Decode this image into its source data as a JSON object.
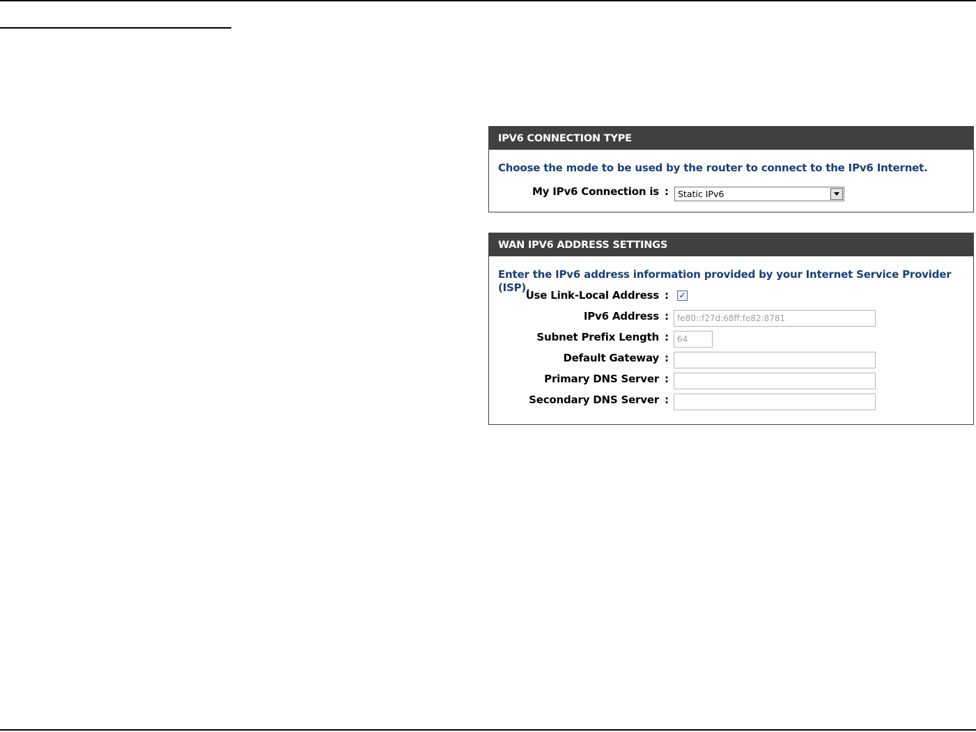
{
  "connection_panel": {
    "header": "IPV6 CONNECTION TYPE",
    "description": "Choose the mode to be used by the router to connect to the IPv6 Internet.",
    "connection_label": "My IPv6 Connection is",
    "colon": ":",
    "connection_value": "Static IPv6"
  },
  "wan_panel": {
    "header": "WAN IPV6 ADDRESS SETTINGS",
    "description": "Enter the IPv6 address information provided by your Internet Service Provider (ISP).",
    "colon": ":",
    "link_local": {
      "label": "Use Link-Local Address",
      "checked": true,
      "mark": "✓"
    },
    "ipv6_address": {
      "label": "IPv6 Address",
      "value": "fe80::f27d:68ff:fe82:8781"
    },
    "subnet_prefix": {
      "label": "Subnet Prefix Length",
      "value": "64"
    },
    "default_gateway": {
      "label": "Default Gateway",
      "value": ""
    },
    "primary_dns": {
      "label": "Primary DNS Server",
      "value": ""
    },
    "secondary_dns": {
      "label": "Secondary DNS Server",
      "value": ""
    }
  },
  "colors": {
    "header_bg": "#404040",
    "header_text": "#ffffff",
    "description_text": "#1a3f7a"
  }
}
